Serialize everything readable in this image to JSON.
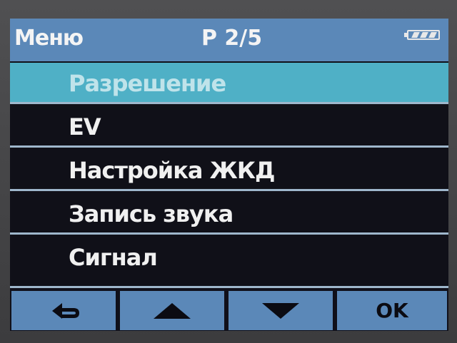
{
  "header": {
    "title": "Меню",
    "page": "P 2/5",
    "battery_icon": "battery-full-icon"
  },
  "menu": {
    "items": [
      {
        "label": "Разрешение",
        "selected": true
      },
      {
        "label": "EV",
        "selected": false
      },
      {
        "label": "Настройка ЖКД",
        "selected": false
      },
      {
        "label": "Запись звука",
        "selected": false
      },
      {
        "label": "Сигнал",
        "selected": false
      }
    ]
  },
  "footer": {
    "back_icon": "back-arrow-icon",
    "up_icon": "triangle-up-icon",
    "down_icon": "triangle-down-icon",
    "ok_label": "OK"
  },
  "colors": {
    "accent": "#5b88b8",
    "highlight": "#4fb0c6",
    "background": "#101018"
  }
}
